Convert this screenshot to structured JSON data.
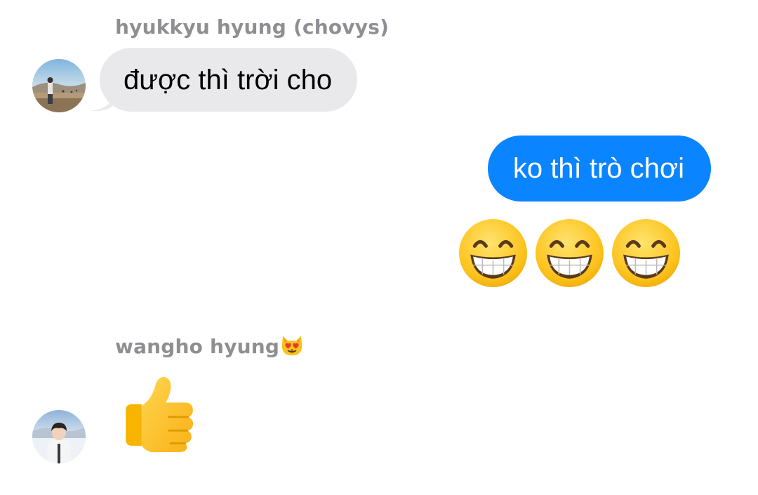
{
  "conversation": {
    "messages": [
      {
        "sender": "hyukkyu hyung (chovys)",
        "direction": "incoming",
        "avatar": "profile-photo",
        "text": "được thì trời cho"
      },
      {
        "direction": "outgoing",
        "text": "ko thì trò chơi"
      },
      {
        "direction": "outgoing",
        "emojis": [
          "grinning-face-icon",
          "grinning-face-icon",
          "grinning-face-icon"
        ]
      },
      {
        "sender": "wangho hyung",
        "sender_emoji": "heart-eyes-cat-icon",
        "direction": "incoming",
        "avatar": "profile-photo",
        "emoji": "thumbs-up-icon"
      }
    ]
  },
  "colors": {
    "incoming_bubble": "#e9e9eb",
    "outgoing_bubble": "#0a84ff",
    "sender_name": "#8e8e93",
    "background": "#ffffff"
  }
}
